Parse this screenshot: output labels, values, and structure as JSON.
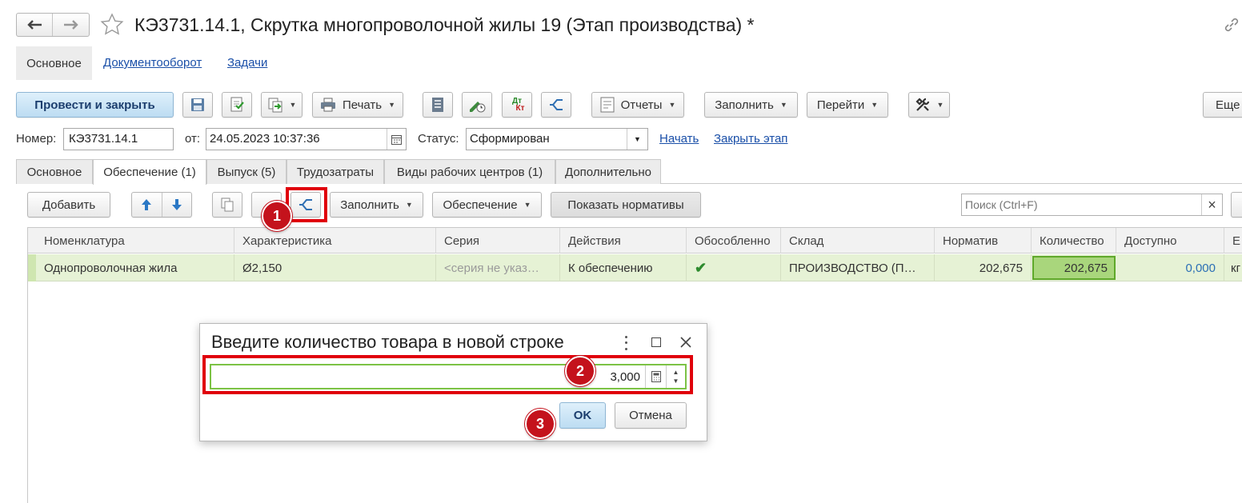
{
  "window": {
    "title": "КЭ3731.14.1, Скрутка многопроволочной жилы 19 (Этап производства) *",
    "sections": [
      "Основное",
      "Документооборот",
      "Задачи"
    ]
  },
  "toolbar": {
    "post_close": "Провести и закрыть",
    "print": "Печать",
    "reports": "Отчеты",
    "fill": "Заполнить",
    "goto": "Перейти",
    "more": "Еще",
    "dtkt_top": "Дт",
    "dtkt_bottom": "Кт"
  },
  "header": {
    "number_label": "Номер:",
    "number_value": "КЭ3731.14.1",
    "date_label": "от:",
    "date_value": "24.05.2023 10:37:36",
    "status_label": "Статус:",
    "status_value": "Сформирован",
    "start_link": "Начать",
    "close_stage_link": "Закрыть этап"
  },
  "tabs": [
    "Основное",
    "Обеспечение (1)",
    "Выпуск (5)",
    "Трудозатраты",
    "Виды рабочих центров (1)",
    "Дополнительно"
  ],
  "table_toolbar": {
    "add": "Добавить",
    "fill": "Заполнить",
    "provision": "Обеспечение",
    "show_norms": "Показать нормативы",
    "search_placeholder": "Поиск (Ctrl+F)",
    "search_clear": "×"
  },
  "table": {
    "columns": [
      "Номенклатура",
      "Характеристика",
      "Серия",
      "Действия",
      "Обособленно",
      "Склад",
      "Норматив",
      "Количество",
      "Доступно",
      "Е"
    ],
    "rows": [
      {
        "nomenclature": "Однопроволочная жила",
        "characteristic": "Ø2,150",
        "series": "<серия не указ…",
        "action": "К обеспечению",
        "separate": "✔",
        "warehouse": "ПРОИЗВОДСТВО (П…",
        "norm": "202,675",
        "quantity": "202,675",
        "available": "0,000",
        "unit": "кг"
      }
    ]
  },
  "dialog": {
    "title": "Введите количество товара в новой строке",
    "value": "3,000",
    "ok": "OK",
    "cancel": "Отмена"
  },
  "annotations": [
    "1",
    "2",
    "3"
  ],
  "colors": {
    "accent_button": "#cfe6f6",
    "row_highlight": "#e6f2d5",
    "annotation_red": "#e0000a",
    "link_blue": "#1a4fa8"
  }
}
